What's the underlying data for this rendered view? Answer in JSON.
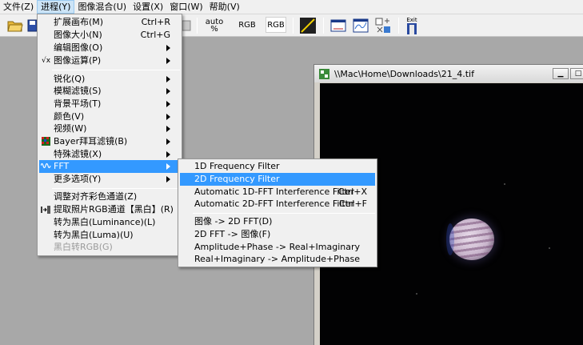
{
  "menubar": {
    "items": [
      "文件(Z)",
      "进程(Y)",
      "图像混合(U)",
      "设置(X)",
      "窗口(W)",
      "帮助(V)"
    ]
  },
  "toolbar": {
    "auto_label": "auto",
    "auto_unit": "%",
    "rgb1": "RGB",
    "rgb2": "RGB",
    "exit_label": "Exit"
  },
  "image_window": {
    "title": "\\\\Mac\\Home\\Downloads\\21_4.tif"
  },
  "main_menu": {
    "items": [
      {
        "label": "扩展画布(M)",
        "shortcut": "Ctrl+R"
      },
      {
        "label": "图像大小(N)",
        "shortcut": "Ctrl+G"
      },
      {
        "label": "编辑图像(O)"
      },
      {
        "label": "图像运算(P)",
        "icon": "√x"
      },
      {
        "label": "锐化(Q)"
      },
      {
        "label": "模糊滤镜(S)"
      },
      {
        "label": "背景平场(T)"
      },
      {
        "label": "颜色(V)"
      },
      {
        "label": "视频(W)"
      },
      {
        "label": "Bayer拜耳滤镜(B)"
      },
      {
        "label": "特殊滤镜(X)"
      },
      {
        "label": "FFT"
      },
      {
        "label": "更多选项(Y)"
      },
      {
        "label": "调整对齐彩色通道(Z)"
      },
      {
        "label": "提取照片RGB通道【黑白】(R)"
      },
      {
        "label": "转为黑白(Luminance)(L)"
      },
      {
        "label": "转为黑白(Luma)(U)"
      },
      {
        "label": "黑白转RGB(G)"
      }
    ]
  },
  "fft_submenu": {
    "items": [
      {
        "label": "1D Frequency Filter"
      },
      {
        "label": "2D Frequency Filter"
      },
      {
        "label": "Automatic 1D-FFT Interference Filter",
        "shortcut": "Ctrl+X"
      },
      {
        "label": "Automatic 2D-FFT Interference Filter",
        "shortcut": "Ctrl+F"
      },
      {
        "label": "图像 -> 2D FFT(D)"
      },
      {
        "label": "2D FFT -> 图像(F)"
      },
      {
        "label": "Amplitude+Phase -> Real+Imaginary"
      },
      {
        "label": "Real+Imaginary -> Amplitude+Phase"
      }
    ]
  },
  "colors": {
    "highlight": "#3399ff",
    "menu_bg": "#f0f0f0"
  }
}
